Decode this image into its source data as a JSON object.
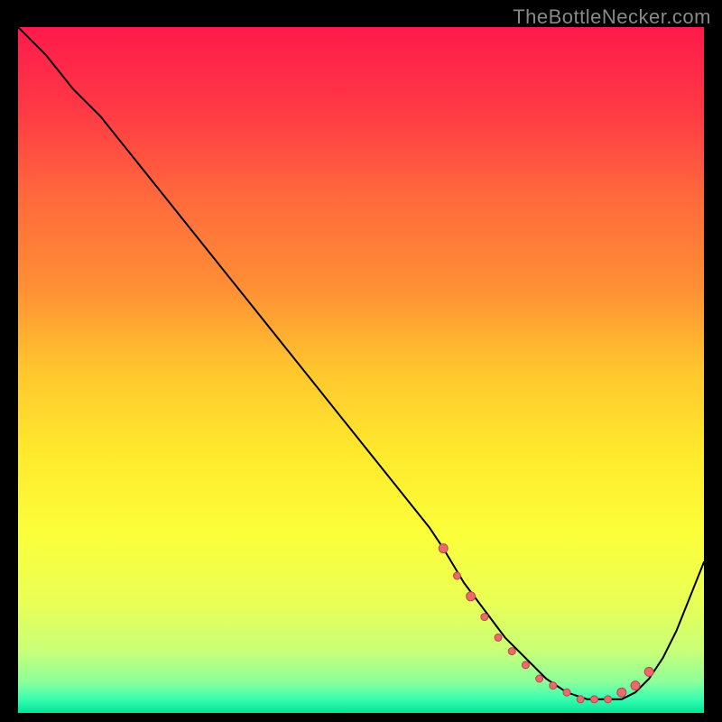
{
  "watermark": "TheBottleNecker.com",
  "colors": {
    "gradient_stops": [
      {
        "offset": 0.0,
        "color": "#ff1a4b"
      },
      {
        "offset": 0.12,
        "color": "#ff3945"
      },
      {
        "offset": 0.25,
        "color": "#ff6a3c"
      },
      {
        "offset": 0.38,
        "color": "#ff8f34"
      },
      {
        "offset": 0.5,
        "color": "#ffc62e"
      },
      {
        "offset": 0.62,
        "color": "#ffe92d"
      },
      {
        "offset": 0.74,
        "color": "#fbff3a"
      },
      {
        "offset": 0.84,
        "color": "#e9ff56"
      },
      {
        "offset": 0.91,
        "color": "#c8ff78"
      },
      {
        "offset": 0.955,
        "color": "#8cff9a"
      },
      {
        "offset": 0.978,
        "color": "#3effb0"
      },
      {
        "offset": 1.0,
        "color": "#00e59a"
      }
    ],
    "curve": "#000000",
    "marker_fill": "#ed6a6a",
    "marker_stroke": "#b34a4a"
  },
  "chart_data": {
    "type": "line",
    "title": "",
    "xlabel": "",
    "ylabel": "",
    "xlim": [
      0,
      100
    ],
    "ylim": [
      0,
      100
    ],
    "grid": false,
    "series": [
      {
        "name": "bottleneck-curve",
        "x": [
          0,
          4,
          8,
          12,
          16,
          20,
          24,
          28,
          32,
          36,
          40,
          44,
          48,
          52,
          56,
          60,
          62,
          65,
          68,
          71,
          74,
          77,
          80,
          83,
          86,
          88,
          90,
          92,
          94,
          96,
          98,
          100
        ],
        "y": [
          100,
          96,
          91,
          87,
          82,
          77,
          72,
          67,
          62,
          57,
          52,
          47,
          42,
          37,
          32,
          27,
          24,
          19,
          15,
          11,
          8,
          5,
          3,
          2,
          2,
          2,
          3,
          5,
          8,
          12,
          17,
          22
        ]
      }
    ],
    "markers": {
      "series": "bottleneck-curve",
      "points": [
        {
          "x": 62,
          "y": 24,
          "r": 5
        },
        {
          "x": 64,
          "y": 20,
          "r": 4
        },
        {
          "x": 66,
          "y": 17,
          "r": 5
        },
        {
          "x": 68,
          "y": 14,
          "r": 4
        },
        {
          "x": 70,
          "y": 11,
          "r": 4
        },
        {
          "x": 72,
          "y": 9,
          "r": 4
        },
        {
          "x": 74,
          "y": 7,
          "r": 4
        },
        {
          "x": 76,
          "y": 5,
          "r": 4
        },
        {
          "x": 78,
          "y": 4,
          "r": 4
        },
        {
          "x": 80,
          "y": 3,
          "r": 4
        },
        {
          "x": 82,
          "y": 2,
          "r": 4
        },
        {
          "x": 84,
          "y": 2,
          "r": 4
        },
        {
          "x": 86,
          "y": 2,
          "r": 4
        },
        {
          "x": 88,
          "y": 3,
          "r": 5
        },
        {
          "x": 90,
          "y": 4,
          "r": 5
        },
        {
          "x": 92,
          "y": 6,
          "r": 5
        }
      ]
    }
  }
}
